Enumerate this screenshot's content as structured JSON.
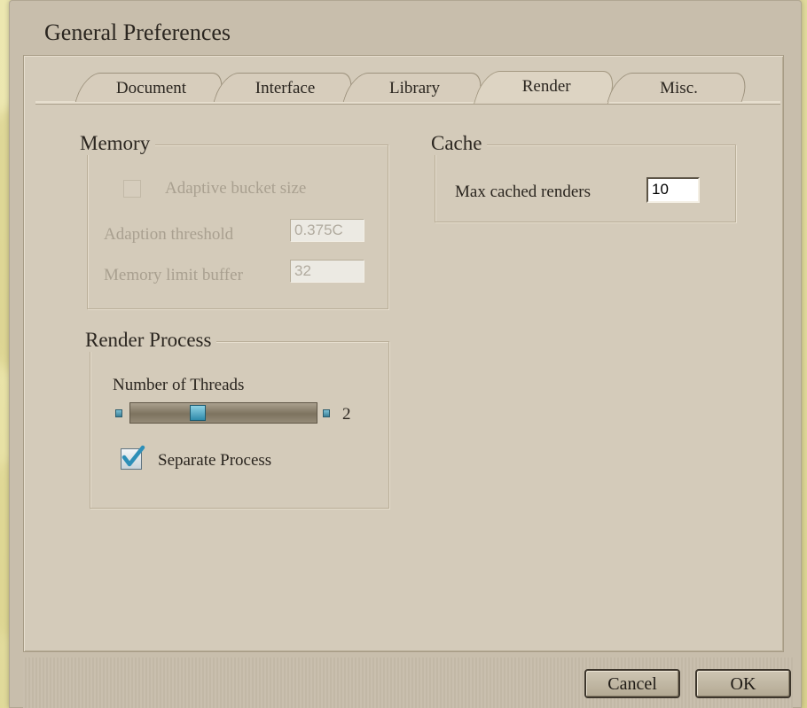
{
  "dialog": {
    "title": "General Preferences"
  },
  "tabs": [
    {
      "label": "Document",
      "active": false
    },
    {
      "label": "Interface",
      "active": false
    },
    {
      "label": "Library",
      "active": false
    },
    {
      "label": "Render",
      "active": true
    },
    {
      "label": "Misc.",
      "active": false
    }
  ],
  "memory": {
    "title": "Memory",
    "adaptive_bucket_size": {
      "label": "Adaptive bucket size",
      "checked": false,
      "enabled": false
    },
    "adaption_threshold": {
      "label": "Adaption threshold",
      "value": "0.375C",
      "enabled": false
    },
    "memory_limit_buffer": {
      "label": "Memory limit buffer",
      "value": "32",
      "enabled": false
    }
  },
  "cache": {
    "title": "Cache",
    "max_cached_renders": {
      "label": "Max cached renders",
      "value": "10"
    }
  },
  "render_process": {
    "title": "Render Process",
    "threads": {
      "label": "Number of Threads",
      "value": "2",
      "slider_fraction": 0.35
    },
    "separate_process": {
      "label": "Separate Process",
      "checked": true
    }
  },
  "buttons": {
    "cancel": "Cancel",
    "ok": "OK"
  },
  "colors": {
    "accent": "#3a9cc0",
    "panel": "#d4cbba",
    "background": "#e9e3a8"
  }
}
